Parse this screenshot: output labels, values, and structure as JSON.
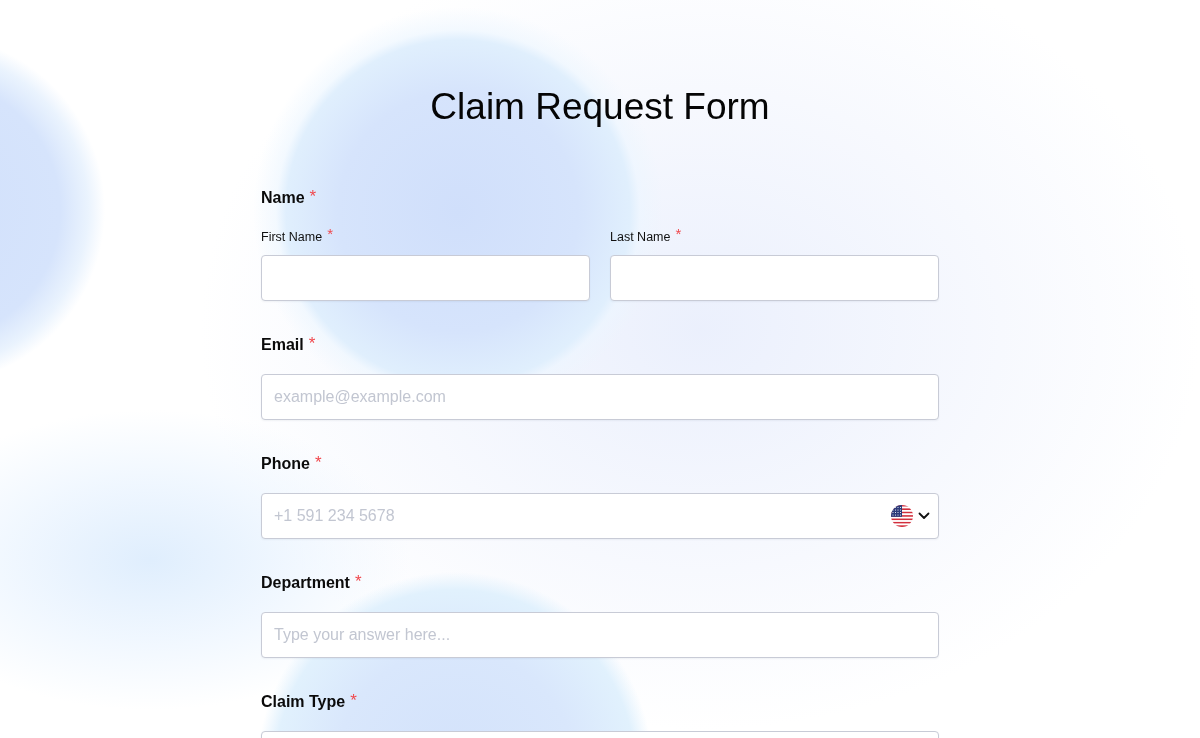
{
  "title": "Claim Request Form",
  "fields": [
    {
      "kind": "name",
      "label": "Name",
      "asterisk": "*",
      "parts": [
        {
          "label": "First Name",
          "asterisk": "*"
        },
        {
          "label": "Last Name",
          "asterisk": "*"
        }
      ]
    },
    {
      "kind": "text",
      "label": "Email",
      "asterisk": "*",
      "placeholder": "example@example.com"
    },
    {
      "kind": "phone",
      "label": "Phone",
      "asterisk": "*",
      "placeholder": "+1 591 234 5678"
    },
    {
      "kind": "text",
      "label": "Department",
      "asterisk": "*",
      "placeholder": "Type your answer here..."
    },
    {
      "kind": "text",
      "label": "Claim Type",
      "asterisk": "*"
    }
  ]
}
